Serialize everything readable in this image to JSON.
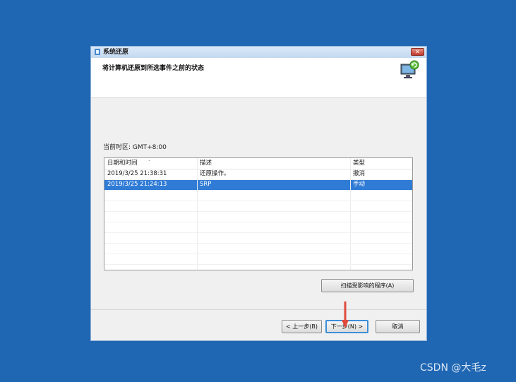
{
  "window": {
    "title": "系统还原",
    "close_label": "✕",
    "header_title": "将计算机还原到所选事件之前的状态"
  },
  "timezone_label": "当前时区: GMT+8:00",
  "table": {
    "columns": [
      "日期和时间",
      "描述",
      "类型"
    ],
    "rows": [
      {
        "datetime": "2019/3/25 21:38:31",
        "description": "还原操作。",
        "type": "撤消",
        "selected": false
      },
      {
        "datetime": "2019/3/25 21:24:13",
        "description": "SRP",
        "type": "手动",
        "selected": true
      }
    ]
  },
  "buttons": {
    "scan": "扫描受影响的程序(A)",
    "back": "< 上一步(B)",
    "next": "下一步(N) >",
    "cancel": "取消"
  },
  "watermark": "CSDN @大毛z",
  "colors": {
    "desktop": "#1f66b3",
    "selection": "#2f7bd6",
    "arrow": "#e04b3c"
  },
  "icons": [
    "system-restore-icon",
    "restore-computer-icon",
    "close-icon",
    "arrow-down-icon"
  ]
}
